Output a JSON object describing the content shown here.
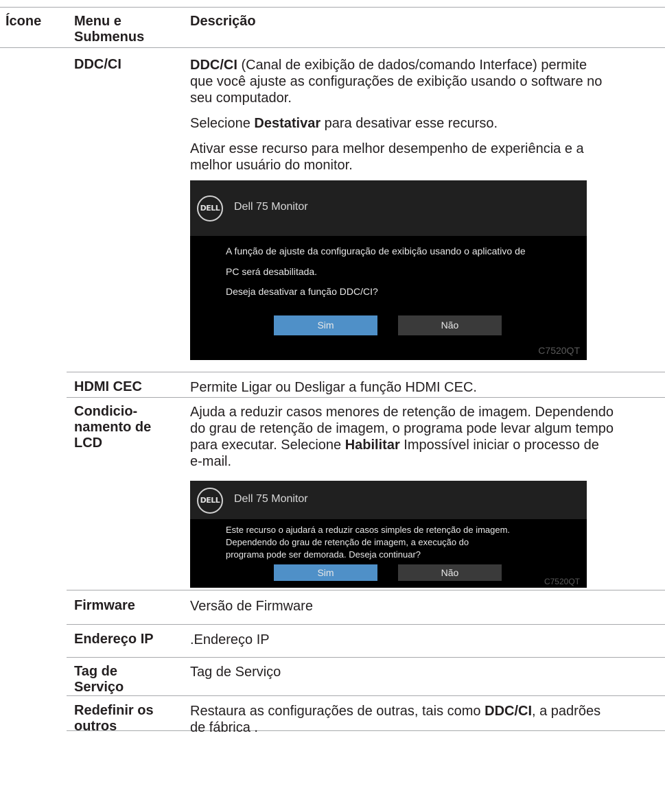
{
  "header": {
    "col_icon": "Ícone",
    "col_menu_line1": "Menu e",
    "col_menu_line2": "Submenus",
    "col_desc": "Descrição"
  },
  "rows": {
    "ddcci": {
      "menu": "DDC/CI",
      "p1_bold": "DDC/CI",
      "p1_rest_line1": " (Canal de exibição de dados/comando Interface) permite",
      "p1_line2": "que você ajuste as configurações de exibição usando o software no",
      "p1_line3": "seu computador.",
      "p2_pre": "Selecione ",
      "p2_bold": "Destativar",
      "p2_post": " para desativar esse recurso.",
      "p3_line1": "Ativar esse recurso para melhor desempenho de experiência e a",
      "p3_line2": "melhor usuário do monitor.",
      "osd": {
        "logo": "DELL",
        "title": "Dell 75 Monitor",
        "msg1": "A função de ajuste da configuração de exibição usando o aplicativo de",
        "msg2": "PC será desabilitada.",
        "msg3": "Deseja desativar a função DDC/CI?",
        "yes": "Sim",
        "no": "Não",
        "model": "C7520QT"
      }
    },
    "hdmi": {
      "menu": "HDMI CEC",
      "desc": "Permite Ligar ou Desligar a função HDMI CEC."
    },
    "lcd": {
      "menu1": "Condicio-",
      "menu2": "namento de",
      "menu3": "LCD",
      "d1": "Ajuda a reduzir casos menores de retenção de imagem. Dependendo",
      "d2": "do grau de retenção de imagem, o programa pode levar algum tempo",
      "d3_pre": "para executar. Selecione ",
      "d3_bold": "Habilitar",
      "d3_post": " Impossível iniciar o processo de",
      "d4": "e-mail.",
      "osd": {
        "logo": "DELL",
        "title": "Dell 75 Monitor",
        "msg1": "Este recurso o ajudará a reduzir casos simples de retenção de imagem.",
        "msg2": "Dependendo do grau de retenção de imagem, a execução do",
        "msg3": "programa pode ser demorada. Deseja continuar?",
        "yes": "Sim",
        "no": "Não",
        "model": "C7520QT"
      }
    },
    "firmware": {
      "menu": "Firmware",
      "desc": "Versão de Firmware"
    },
    "ip": {
      "menu": "Endereço IP",
      "desc": ".Endereço IP"
    },
    "tag": {
      "menu1": "Tag de",
      "menu2": "Serviço",
      "desc": "Tag de Serviço"
    },
    "reset": {
      "menu1": "Redefinir os",
      "menu2": "outros",
      "d1_pre": "Restaura as configurações de outras, tais como ",
      "d1_bold": "DDC/CI",
      "d1_post": ", a padrões",
      "d2": "de fábrica ."
    }
  }
}
